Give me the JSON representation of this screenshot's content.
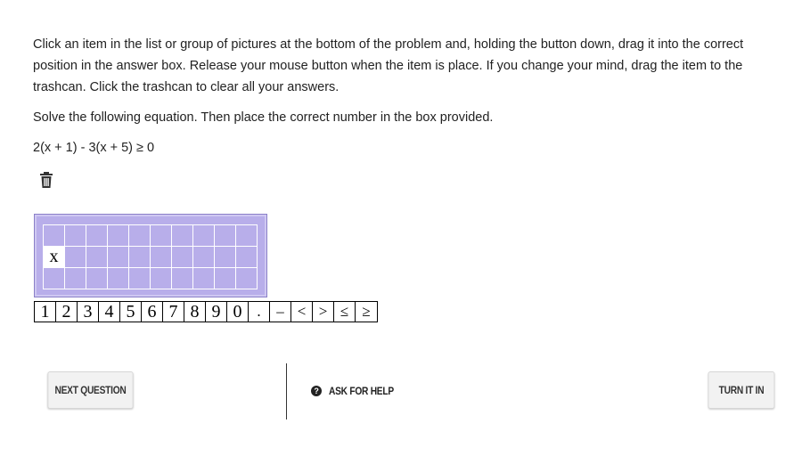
{
  "instructions": "Click an item in the list or group of pictures at the bottom of the problem and, holding the button down, drag it into the correct position in the answer box. Release your mouse button when the item is place. If you change your mind, drag the item to the trashcan. Click the trashcan to clear all your answers.",
  "prompt": "Solve the following equation. Then place the correct number in the box provided.",
  "equation": "2(x + 1) - 3(x + 5) ≥ 0",
  "trash_icon": "trash-icon",
  "answer_grid": {
    "rows": 3,
    "cols": 10,
    "filled_cell": {
      "row": 1,
      "col": 0,
      "value": "x"
    }
  },
  "palette": [
    "1",
    "2",
    "3",
    "4",
    "5",
    "6",
    "7",
    "8",
    "9",
    "0",
    ".",
    "–",
    "<",
    ">",
    "≤",
    "≥"
  ],
  "buttons": {
    "next": "NEXT QUESTION",
    "help": "ASK FOR HELP",
    "turn_in": "TURN IT IN"
  },
  "help_icon": "question-circle-icon"
}
